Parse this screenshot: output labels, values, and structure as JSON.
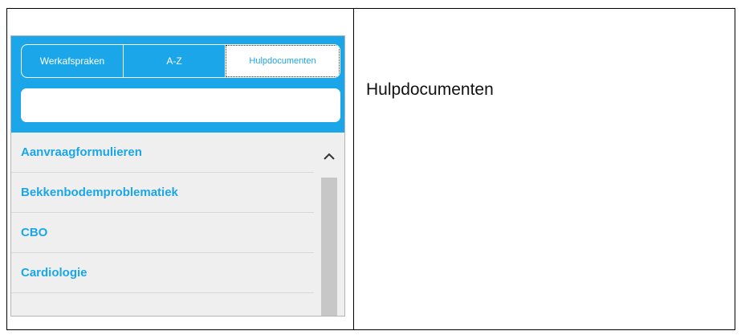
{
  "tabs": [
    {
      "label": "Werkafspraken"
    },
    {
      "label": "A-Z"
    },
    {
      "label": "Hulpdocumenten"
    }
  ],
  "search": {
    "value": "",
    "placeholder": ""
  },
  "list": {
    "items": [
      {
        "label": "Aanvraagformulieren"
      },
      {
        "label": "Bekkenbodemproblematiek"
      },
      {
        "label": "CBO"
      },
      {
        "label": "Cardiologie"
      }
    ]
  },
  "caption": {
    "text": "Hulpdocumenten"
  },
  "colors": {
    "accent": "#1aa6e8",
    "list_bg": "#efefef",
    "scroll_thumb": "#c7c7c7"
  },
  "icons": {
    "scroll_up": "chevron-up-icon"
  }
}
